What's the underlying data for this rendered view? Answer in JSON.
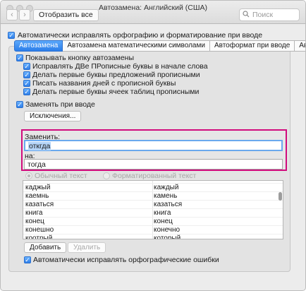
{
  "window": {
    "title": "Автозамена: Английский (США)",
    "show_all": "Отобразить все",
    "nav_back": "‹",
    "nav_forward": "›",
    "search_placeholder": "Поиск"
  },
  "options": {
    "auto_correct_spelling": "Автоматически исправлять орфографию и форматирование при вводе"
  },
  "tabs": [
    "Автозамена",
    "Автозамена математическими символами",
    "Автоформат при вводе",
    "Автотекст"
  ],
  "autocorrect": {
    "show_button": "Показывать кнопку автозамены",
    "items": [
      "Исправлять ДВе ПРописные буквы в начале слова",
      "Делать первые буквы предложений прописными",
      "Писать названия дней с прописной буквы",
      "Делать первые буквы ячеек таблиц прописными"
    ],
    "replace_on_type": "Заменять при вводе",
    "exceptions_button": "Исключения...",
    "replace_label": "Заменить:",
    "replace_value": "откгда",
    "with_label": "на:",
    "with_value": "тогда",
    "plain_text": "Обычный текст",
    "formatted_text": "Форматированный текст",
    "table": [
      [
        "каджый",
        "каждый"
      ],
      [
        "каемнь",
        "камень"
      ],
      [
        "казаться",
        "казаться"
      ],
      [
        "книга",
        "книга"
      ],
      [
        "конец",
        "конец"
      ],
      [
        "конешно",
        "конечно"
      ],
      [
        "коотрый",
        "который"
      ]
    ],
    "add_button": "Добавить",
    "delete_button": "Удалить",
    "auto_fix_spelling": "Автоматически исправлять орфографические ошибки"
  },
  "colors": {
    "accent": "#2b7de9",
    "highlight_border": "#d10c7d"
  }
}
